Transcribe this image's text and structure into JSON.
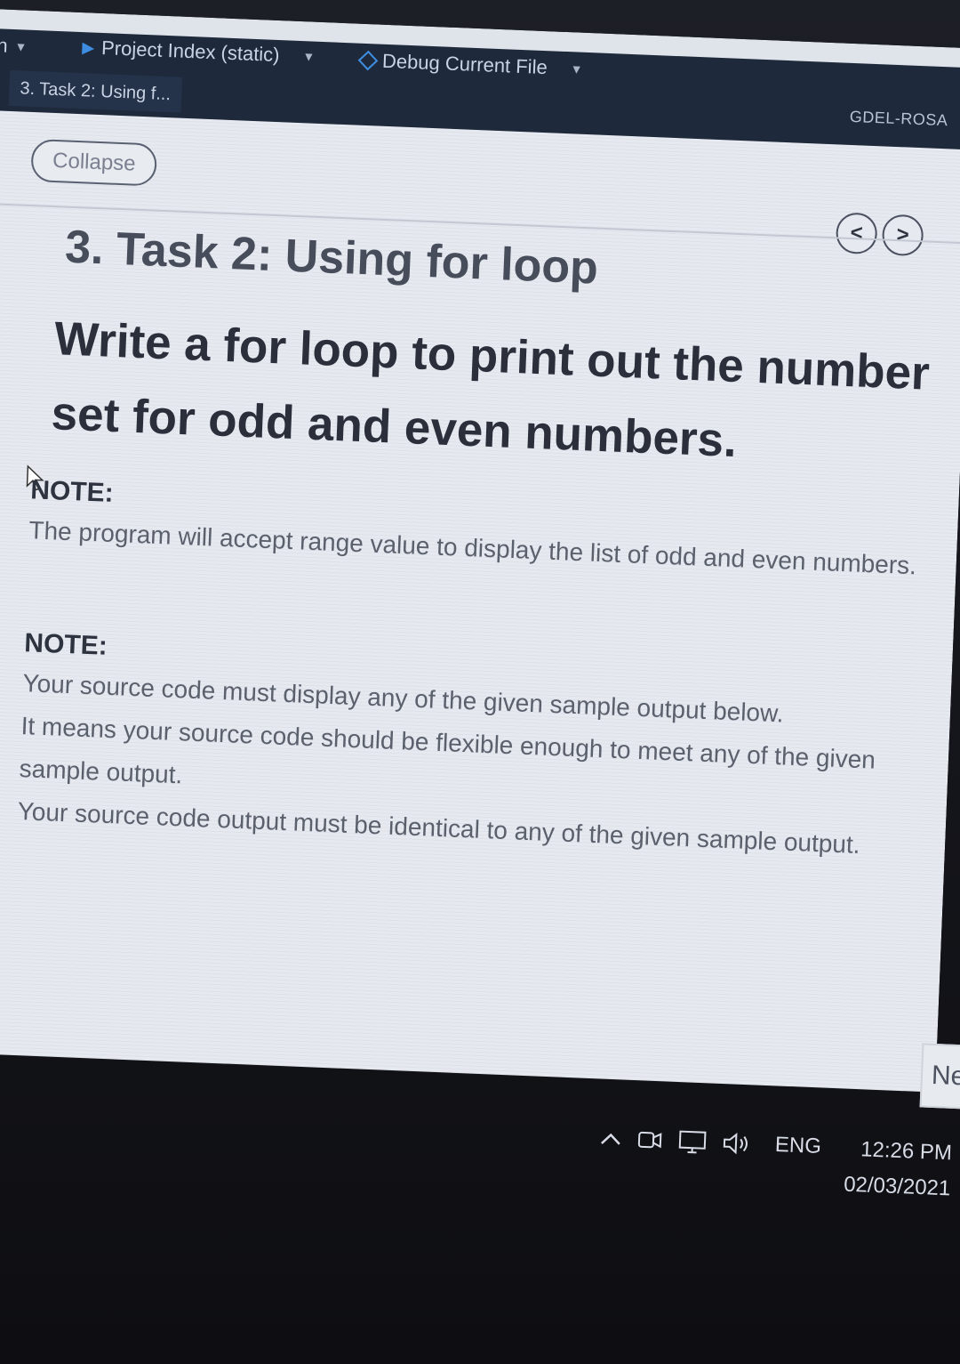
{
  "topbar": {
    "left_fragment": "n",
    "project_index": "Project Index (static)",
    "debug_label": "Debug Current File",
    "active_tab": "3. Task 2: Using f...",
    "user": "GDEL-ROSA"
  },
  "lesson": {
    "collapse_label": "Collapse",
    "prev_label": "<",
    "next_label": ">",
    "title": "3. Task 2: Using for loop",
    "heading": "Write a for loop to print out the number set for odd and even numbers.",
    "note1_label": "NOTE:",
    "note1_text": "The program will accept range value to display the list of odd and even numbers.",
    "note2_label": "NOTE:",
    "note2_lines": [
      "Your source code must display any of the given sample output below.",
      "It means your source code should be flexible enough to meet any of the given sample output.",
      "Your source code output must be identical to any of the given sample output."
    ],
    "next_button": "Ne"
  },
  "taskbar": {
    "language": "ENG",
    "time": "12:26 PM",
    "date": "02/03/2021"
  }
}
